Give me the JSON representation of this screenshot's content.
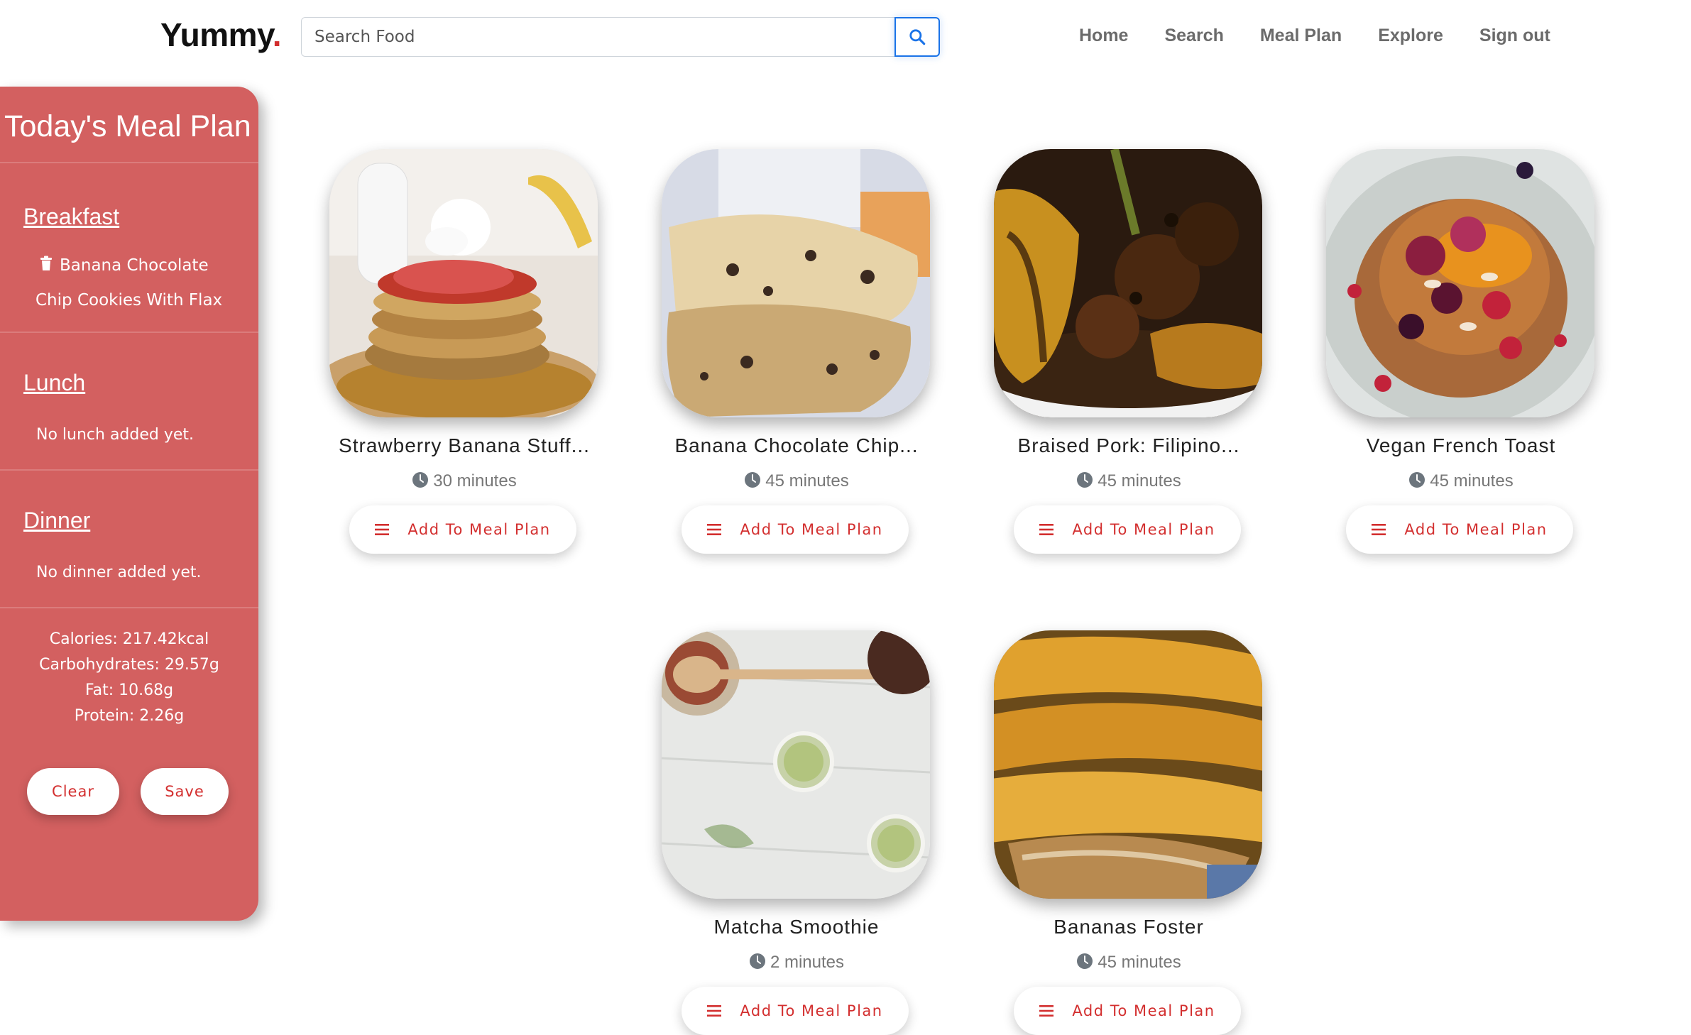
{
  "header": {
    "brand": "Yummy",
    "brand_dot": ".",
    "search_placeholder": "Search Food",
    "nav": [
      "Home",
      "Search",
      "Meal Plan",
      "Explore",
      "Sign out"
    ]
  },
  "sidebar": {
    "title": "Today's Meal Plan",
    "breakfast": {
      "label": "Breakfast",
      "items": [
        "Banana Chocolate Chip Cookies With Flax"
      ]
    },
    "lunch": {
      "label": "Lunch",
      "empty": "No lunch added yet."
    },
    "dinner": {
      "label": "Dinner",
      "empty": "No dinner added yet."
    },
    "nutrition": {
      "calories": "Calories: 217.42kcal",
      "carbs": "Carbohydrates: 29.57g",
      "fat": "Fat: 10.68g",
      "protein": "Protein: 2.26g"
    },
    "clear_label": "Clear",
    "save_label": "Save"
  },
  "recipes": [
    {
      "title": "Strawberry Banana Stuff...",
      "time": "30 minutes",
      "button": "Add To Meal Plan",
      "image": "pancakes-strawberry-cream"
    },
    {
      "title": "Banana Chocolate Chip...",
      "time": "45 minutes",
      "button": "Add To Meal Plan",
      "image": "chocolate-chip-cookies"
    },
    {
      "title": "Braised Pork: Filipino...",
      "time": "45 minutes",
      "button": "Add To Meal Plan",
      "image": "braised-pork-plantains"
    },
    {
      "title": "Vegan French Toast",
      "time": "45 minutes",
      "button": "Add To Meal Plan",
      "image": "french-toast-berries"
    },
    {
      "title": "Matcha Smoothie",
      "time": "2 minutes",
      "button": "Add To Meal Plan",
      "image": "matcha-smoothie-jars"
    },
    {
      "title": "Bananas Foster",
      "time": "45 minutes",
      "button": "Add To Meal Plan",
      "image": "caramelized-bananas"
    }
  ],
  "colors": {
    "accent": "#d32f2f",
    "sidebar": "#d36060",
    "search_border": "#1a73e8"
  }
}
